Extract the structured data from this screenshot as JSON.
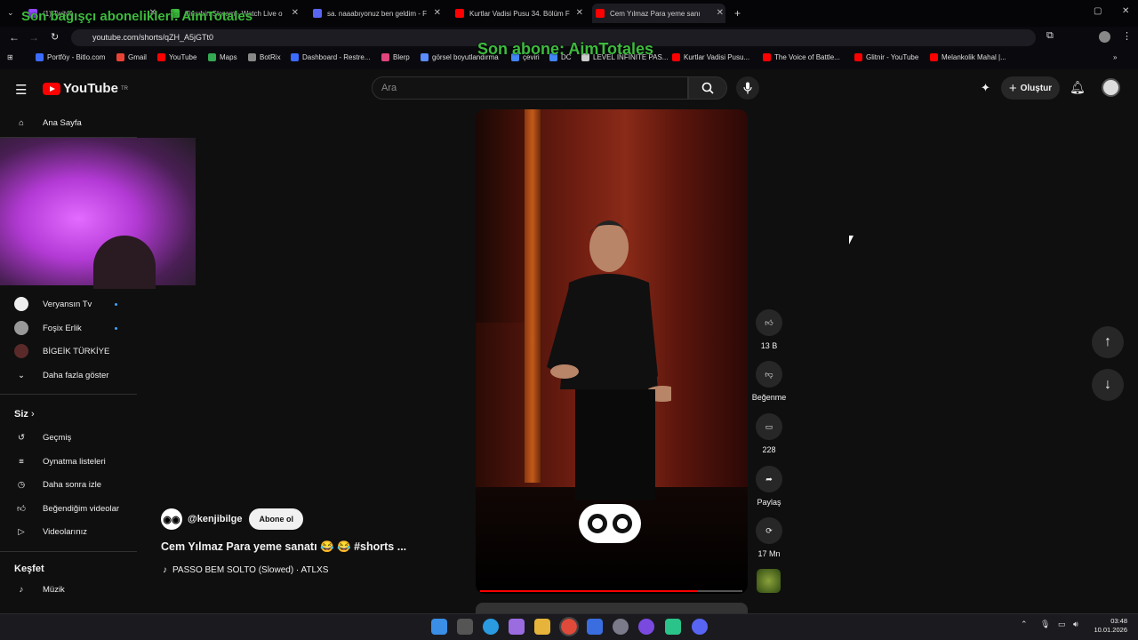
{
  "browser": {
    "tabs": [
      {
        "label": "(1) Twitch",
        "color": "#9146ff"
      },
      {
        "label": "Zinsrbin Stream - Watch Live o",
        "color": "#3dbb3d"
      },
      {
        "label": "sa. naaabıyonuz ben geldim - F",
        "color": "#5865f2"
      },
      {
        "label": "Kurtlar Vadisi Pusu 34. Bölüm F",
        "color": "#ff0000"
      },
      {
        "label": "Cem Yılmaz Para yeme sanı",
        "color": "#ff0000"
      }
    ],
    "new_tab": "+",
    "url": "youtube.com/shorts/qZH_A5jGTt0",
    "bookmarks": [
      {
        "label": "Portföy - Bitlo.com",
        "color": "#3b6cff"
      },
      {
        "label": "Gmail",
        "color": "#ea4335"
      },
      {
        "label": "YouTube",
        "color": "#ff0000"
      },
      {
        "label": "Maps",
        "color": "#34a853"
      },
      {
        "label": "BotRix",
        "color": "#888888"
      },
      {
        "label": "Dashboard - Restre...",
        "color": "#3b6cff"
      },
      {
        "label": "Blerp",
        "color": "#e0457b"
      },
      {
        "label": "görsel boyutlandırma",
        "color": "#5a8cff"
      },
      {
        "label": "çeviri",
        "color": "#4285f4"
      },
      {
        "label": "DC",
        "color": "#4285f4"
      },
      {
        "label": "LEVEL INFINITE PAS...",
        "color": "#cccccc"
      },
      {
        "label": "Kurtlar Vadisi Pusu...",
        "color": "#ff0000"
      },
      {
        "label": "The Voice of Battle...",
        "color": "#ff0000"
      },
      {
        "label": "Glitnir - YouTube",
        "color": "#ff0000"
      },
      {
        "label": "Melankolik Mahal |...",
        "color": "#ff0000"
      }
    ]
  },
  "overlay": {
    "donor": "Son bağışçı abonelikleri: AimTotales",
    "subscriber": "Son abone: AimTotales"
  },
  "youtube": {
    "logo": "YouTube",
    "region": "TR",
    "search_placeholder": "Ara",
    "create_label": "Oluştur"
  },
  "sidebar": {
    "home": "Ana Sayfa",
    "subscriptions": [
      "Veryansın Tv",
      "Foşix Erlik",
      "BİGEİK TÜRKİYE"
    ],
    "show_more": "Daha fazla göster",
    "you_header": "Siz",
    "you_items": [
      "Geçmiş",
      "Oynatma listeleri",
      "Daha sonra izle",
      "Beğendiğim videolar",
      "Videolarınız"
    ],
    "explore_header": "Keşfet",
    "explore_items": [
      "Müzik"
    ]
  },
  "short": {
    "channel": "@kenjibilge",
    "subscribe": "Abone ol",
    "title": "Cem Yılmaz Para yeme sanatı 😂 😂 #shorts ...",
    "sound": "PASSO BEM SOLTO (Slowed) · ATLXS",
    "progress": 0.83,
    "likes": "13 B",
    "dislike_label": "Beğenme",
    "comments": "228",
    "share_label": "Paylaş",
    "remix": "17 Mn"
  },
  "taskbar": {
    "time": "03:48",
    "date": "10.01.2026"
  }
}
